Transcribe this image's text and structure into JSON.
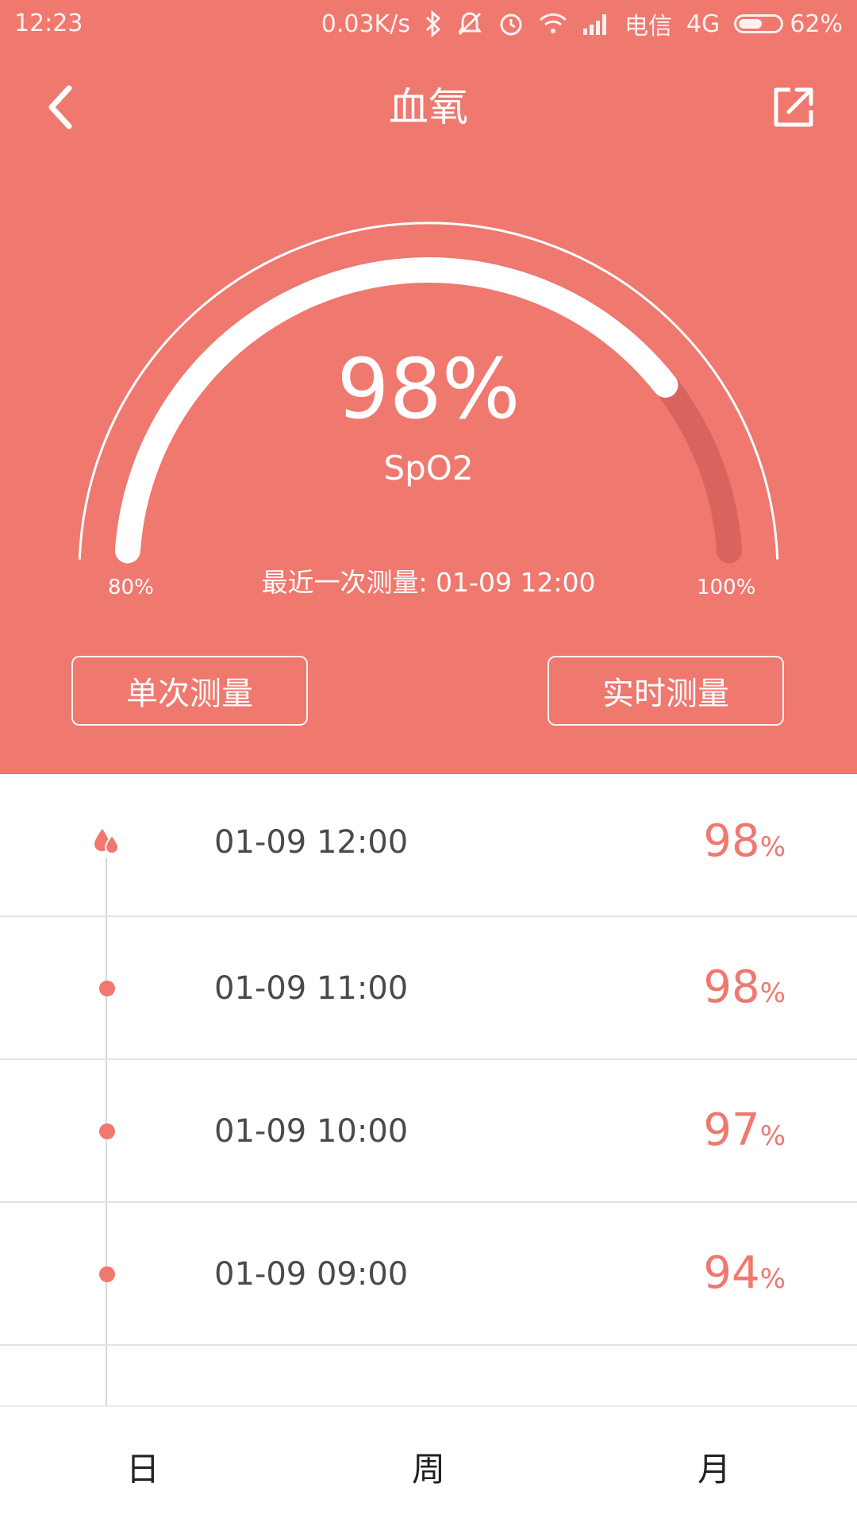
{
  "status_bar": {
    "time": "12:23",
    "network_speed": "0.03K/s",
    "carrier": "电信",
    "network_type": "4G",
    "battery_percent": "62%",
    "battery_level": 0.62,
    "icons": [
      "bluetooth-icon",
      "mute-icon",
      "alarm-icon",
      "wifi-icon",
      "signal-icon",
      "battery-icon"
    ]
  },
  "header": {
    "title": "血氧",
    "back_icon": "chevron-left-icon",
    "share_icon": "share-external-icon"
  },
  "gauge": {
    "value": "98%",
    "value_numeric": 98,
    "label": "SpO2",
    "min_label": "80%",
    "max_label": "100%",
    "min": 80,
    "max": 100,
    "last_measure": "最近一次测量: 01-09 12:00"
  },
  "buttons": {
    "single": "单次测量",
    "realtime": "实时测量"
  },
  "records": [
    {
      "time": "01-09 12:00",
      "value": "98",
      "unit": "%",
      "marker": "blood-drop-icon"
    },
    {
      "time": "01-09 11:00",
      "value": "98",
      "unit": "%",
      "marker": "dot"
    },
    {
      "time": "01-09 10:00",
      "value": "97",
      "unit": "%",
      "marker": "dot"
    },
    {
      "time": "01-09 09:00",
      "value": "94",
      "unit": "%",
      "marker": "dot"
    }
  ],
  "tabs": {
    "day": "日",
    "week": "周",
    "month": "月"
  },
  "colors": {
    "accent": "#ef786f",
    "gauge_track_dark": "#d9645e",
    "text_dark": "#4a4a4a"
  }
}
